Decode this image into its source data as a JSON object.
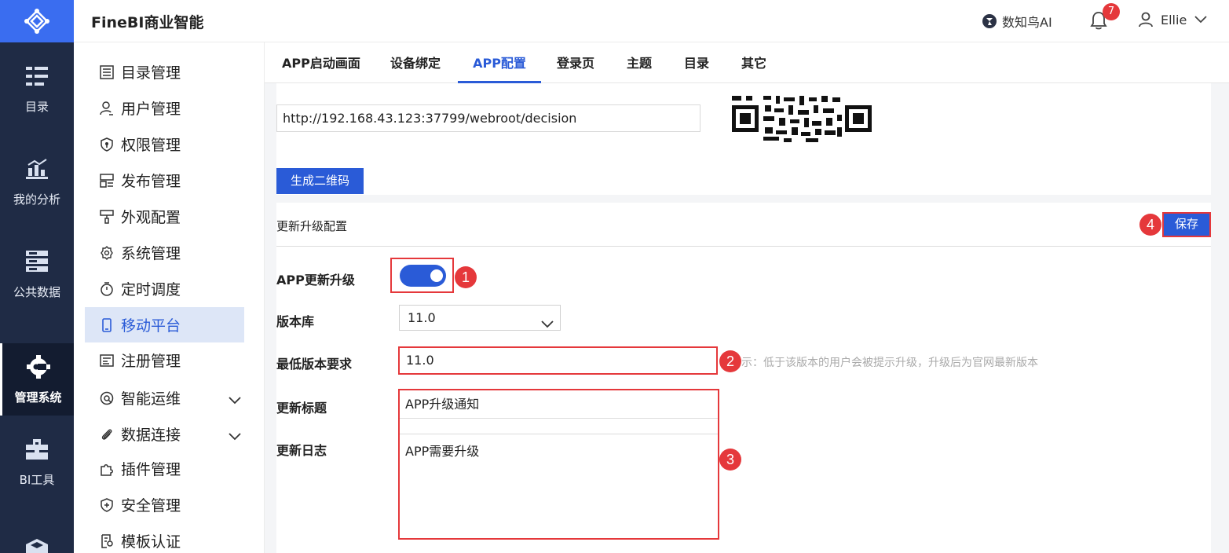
{
  "app": {
    "brand": "FineBI商业智能"
  },
  "header": {
    "ai_label": "数知鸟AI",
    "notification_count": "7",
    "user_name": "Ellie"
  },
  "rail": {
    "items": [
      {
        "label": "目录",
        "icon": "list-icon"
      },
      {
        "label": "我的分析",
        "icon": "chart-icon"
      },
      {
        "label": "公共数据",
        "icon": "database-icon"
      },
      {
        "label": "管理系统",
        "icon": "settings-icon",
        "active": true
      },
      {
        "label": "BI工具",
        "icon": "toolbox-icon"
      }
    ]
  },
  "submenu": {
    "items": [
      {
        "label": "目录管理",
        "icon": "list-icon"
      },
      {
        "label": "用户管理",
        "icon": "user-icon"
      },
      {
        "label": "权限管理",
        "icon": "shield-icon"
      },
      {
        "label": "发布管理",
        "icon": "layout-icon"
      },
      {
        "label": "外观配置",
        "icon": "brush-icon"
      },
      {
        "label": "系统管理",
        "icon": "gear-icon"
      },
      {
        "label": "定时调度",
        "icon": "timer-icon"
      },
      {
        "label": "移动平台",
        "icon": "mobile-icon",
        "active": true
      },
      {
        "label": "注册管理",
        "icon": "register-icon"
      },
      {
        "label": "智能运维",
        "icon": "ops-icon",
        "expandable": true
      },
      {
        "label": "数据连接",
        "icon": "paperclip-icon",
        "expandable": true
      },
      {
        "label": "插件管理",
        "icon": "puzzle-icon"
      },
      {
        "label": "安全管理",
        "icon": "security-icon"
      },
      {
        "label": "模板认证",
        "icon": "certificate-icon"
      }
    ]
  },
  "tabs": [
    {
      "label": "APP启动画面"
    },
    {
      "label": "设备绑定"
    },
    {
      "label": "APP配置",
      "active": true
    },
    {
      "label": "登录页"
    },
    {
      "label": "主题"
    },
    {
      "label": "目录"
    },
    {
      "label": "其它"
    }
  ],
  "qr_section": {
    "url_value": "http://192.168.43.123:37799/webroot/decision",
    "generate_button": "生成二维码"
  },
  "update_section": {
    "title": "更新升级配置",
    "save_button": "保存",
    "app_update_label": "APP更新升级",
    "app_update_enabled": true,
    "version_lib_label": "版本库",
    "version_lib_value": "11.0",
    "min_version_label": "最低版本要求",
    "min_version_value": "11.0",
    "min_version_hint": "示：低于该版本的用户会被提示升级，升级后为官网最新版本",
    "update_title_label": "更新标题",
    "update_title_value": "APP升级通知",
    "update_log_label": "更新日志",
    "update_log_value": "APP需要升级"
  },
  "annotations": [
    "1",
    "2",
    "3",
    "4"
  ],
  "colors": {
    "accent": "#2a5bd7",
    "rail_bg": "#1f2b45",
    "logo_bg": "#3a6df0",
    "highlight_red": "#e5383b",
    "active_menu_bg": "#dde6f7"
  }
}
